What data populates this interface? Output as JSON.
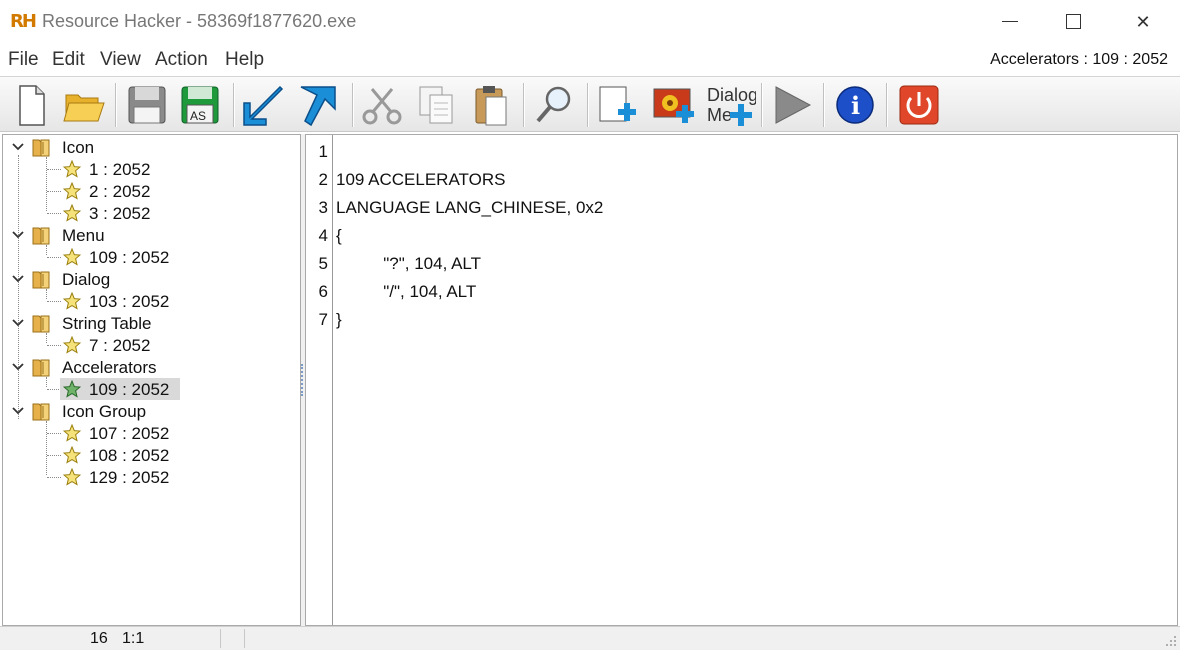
{
  "window": {
    "app_icon_text": "RH",
    "title": "Resource Hacker - 58369f1877620.exe",
    "minimize_glyph": "—",
    "close_glyph": "✕"
  },
  "menu": {
    "items": [
      "File",
      "Edit",
      "View",
      "Action",
      "Help"
    ],
    "status_right": "Accelerators : 109 : 2052"
  },
  "toolbar": {
    "buttons": [
      {
        "name": "new-file-icon"
      },
      {
        "name": "open-folder-icon"
      },
      {
        "name": "save-icon"
      },
      {
        "name": "save-as-icon",
        "text": "AS"
      },
      {
        "name": "compile-icon"
      },
      {
        "name": "bookmark-icon"
      },
      {
        "name": "cut-icon"
      },
      {
        "name": "copy-icon"
      },
      {
        "name": "paste-icon"
      },
      {
        "name": "find-icon"
      },
      {
        "name": "add-resource-icon"
      },
      {
        "name": "add-image-resource-icon"
      },
      {
        "name": "dialog-menu-icon",
        "line1": "Dialog",
        "line2": "Me"
      },
      {
        "name": "play-icon"
      },
      {
        "name": "info-icon",
        "text": "i"
      },
      {
        "name": "power-icon"
      }
    ]
  },
  "tree": {
    "groups": [
      {
        "label": "Icon",
        "children": [
          "1 : 2052",
          "2 : 2052",
          "3 : 2052"
        ]
      },
      {
        "label": "Menu",
        "children": [
          "109 : 2052"
        ]
      },
      {
        "label": "Dialog",
        "children": [
          "103 : 2052"
        ]
      },
      {
        "label": "String Table",
        "children": [
          "7 : 2052"
        ]
      },
      {
        "label": "Accelerators",
        "children": [
          "109 : 2052"
        ],
        "selected_child": 0
      },
      {
        "label": "Icon Group",
        "children": [
          "107 : 2052",
          "108 : 2052",
          "129 : 2052"
        ]
      }
    ]
  },
  "editor": {
    "line_numbers": [
      "1",
      "2",
      "3",
      "4",
      "5",
      "6",
      "7"
    ],
    "lines": [
      "",
      "109 ACCELERATORS",
      "LANGUAGE LANG_CHINESE, 0x2",
      "{",
      "          \"?\", 104, ALT",
      "          \"/\", 104, ALT",
      "}"
    ]
  },
  "statusbar": {
    "col1": "16",
    "col2": "1:1"
  },
  "colors": {
    "accent_blue": "#1a8fd8",
    "selected_row": "#d9d9d9",
    "info_blue": "#1d4fc8",
    "power_red": "#e0462a"
  }
}
